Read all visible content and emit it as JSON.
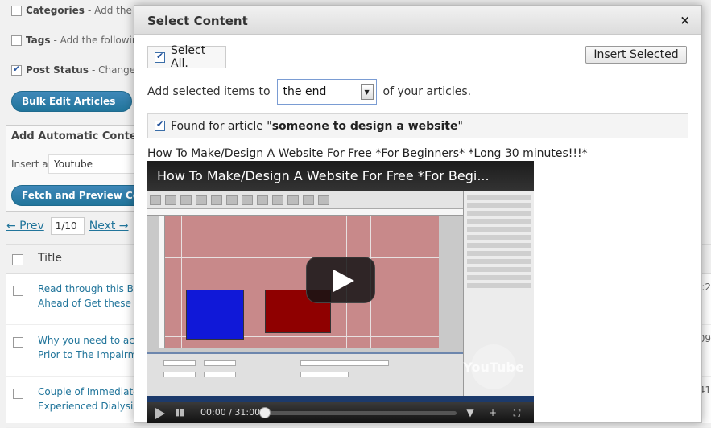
{
  "background": {
    "options": [
      {
        "label": "Categories",
        "desc": "- Add the foll",
        "checked": false
      },
      {
        "label": "Tags",
        "desc": "- Add the following",
        "checked": false
      },
      {
        "label": "Post Status",
        "desc": "- Change th",
        "checked": true
      }
    ],
    "bulk_edit_label": "Bulk Edit Articles",
    "auto_content_title": "Add Automatic Content",
    "insert_label": "Insert a",
    "insert_value": "Youtube",
    "fetch_label": "Fetch and Preview Conte",
    "pager": {
      "prev": "← Prev",
      "page": "1/10",
      "next": "Next →"
    },
    "table": {
      "title_header": "Title",
      "rows": [
        {
          "line1": "Read through this Be",
          "line2": "Ahead of Get these W",
          "right": ":2"
        },
        {
          "line1": "Why you need to acqu",
          "line2": "Prior to The Impairme",
          "right": "09"
        },
        {
          "line1": "Couple of Immediate",
          "line2": "Experienced Dialysis",
          "right": "41"
        }
      ]
    }
  },
  "modal": {
    "title": "Select Content",
    "close_symbol": "×",
    "select_all_label": "Select All.",
    "select_all_checked": true,
    "insert_selected_label": "Insert Selected",
    "add_prefix": "Add selected items to",
    "add_position": "the end",
    "add_suffix": "of your articles.",
    "found_prefix": "Found for article \"",
    "found_article": "someone to design a website",
    "found_suffix": "\"",
    "found_checked": true,
    "video_link": "How To Make/Design A Website For Free *For Beginners* *Long 30 minutes!!!*",
    "player": {
      "title": "How To Make/Design A Website For Free *For Begi...",
      "time": "00:00 / 31:00",
      "progress": 0,
      "logo": "YouTube"
    }
  },
  "colors": {
    "wp_blue": "#21759b",
    "canvas_pink": "#c8898a",
    "box_blue": "#1018d8",
    "box_red": "#8f0000"
  },
  "icons": [
    "close-icon",
    "checkbox-icon",
    "dropdown-arrow-icon",
    "play-icon",
    "volume-icon",
    "fullscreen-icon",
    "add-icon"
  ]
}
